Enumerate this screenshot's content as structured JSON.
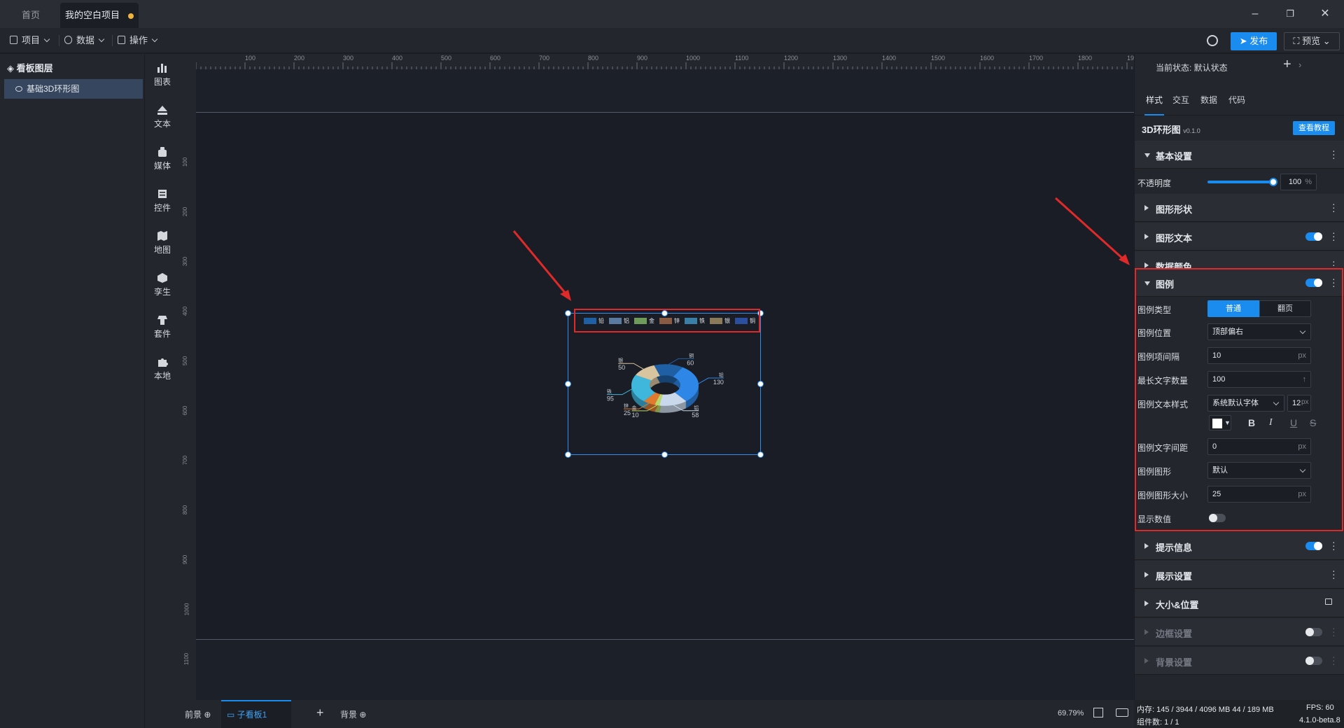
{
  "titlebar": {
    "tabs": [
      {
        "label": "首页"
      },
      {
        "label": "我的空白项目"
      }
    ]
  },
  "menubar": {
    "items": [
      {
        "label": "项目"
      },
      {
        "label": "数据"
      },
      {
        "label": "操作"
      }
    ],
    "publish_label": "发布",
    "preview_label": "预览"
  },
  "layers": {
    "title": "看板图层",
    "items": [
      {
        "label": "基础3D环形图"
      }
    ]
  },
  "toolbox": {
    "items": [
      {
        "label": "图表",
        "icon": "chart-icon"
      },
      {
        "label": "文本",
        "icon": "text-icon"
      },
      {
        "label": "媒体",
        "icon": "media-icon"
      },
      {
        "label": "控件",
        "icon": "control-icon"
      },
      {
        "label": "地图",
        "icon": "map-icon"
      },
      {
        "label": "孪生",
        "icon": "twin-icon"
      },
      {
        "label": "套件",
        "icon": "kit-icon"
      },
      {
        "label": "本地",
        "icon": "puzzle-icon"
      }
    ]
  },
  "ruler": {
    "top": [
      "100",
      "200",
      "300",
      "400",
      "500",
      "600",
      "700",
      "800",
      "900",
      "1000",
      "1100",
      "1200",
      "1300",
      "1400",
      "1500",
      "1600",
      "1700",
      "1800",
      "1900"
    ],
    "left": [
      "100",
      "200",
      "300",
      "400",
      "500",
      "600",
      "700",
      "800",
      "900",
      "1000",
      "1100"
    ]
  },
  "chart_widget": {
    "legend": [
      {
        "name": "铅",
        "color": "#1f5fa3"
      },
      {
        "name": "铝",
        "color": "#5a7aa0"
      },
      {
        "name": "金",
        "color": "#6e9a5a"
      },
      {
        "name": "锌",
        "color": "#8a5b43"
      },
      {
        "name": "铁",
        "color": "#3a7fa8"
      },
      {
        "name": "银",
        "color": "#8a7a5a"
      },
      {
        "name": "铜",
        "color": "#2b4f9e"
      }
    ]
  },
  "chart_data": {
    "type": "pie",
    "categories": [
      "铅",
      "铝",
      "金",
      "锌",
      "铁",
      "银",
      "铜"
    ],
    "values": [
      130,
      58,
      10,
      25,
      95,
      50,
      60
    ],
    "colors": [
      "#2e86e6",
      "#c9d8ea",
      "#b8d86a",
      "#e07a2e",
      "#3fb6dc",
      "#d9c4a0",
      "#1f5fa3"
    ],
    "title": "",
    "donut": true,
    "legend_position": "top-right"
  },
  "bottombar": {
    "front_label": "前景",
    "board_label": "子看板1",
    "back_label": "背景",
    "zoom": "69.79%"
  },
  "panel": {
    "state_label": "当前状态:  默认状态",
    "tabs": [
      "样式",
      "交互",
      "数据",
      "代码"
    ],
    "component_name": "3D环形图",
    "version": "v0.1.0",
    "tutorial_label": "查看教程",
    "sections": {
      "basic": "基本设置",
      "opacity_label": "不透明度",
      "opacity_value": "100",
      "opacity_unit": "%",
      "opacity_level": 1.0,
      "shape": "图形形状",
      "text": "图形文本",
      "color": "数据颜色",
      "legend": "图例",
      "tooltip": "提示信息",
      "display": "展示设置",
      "size": "大小&位置",
      "border": "边框设置",
      "background": "背景设置"
    },
    "legend_settings": {
      "type_label": "图例类型",
      "type_options": [
        "普通",
        "翻页"
      ],
      "position_label": "图例位置",
      "position_value": "顶部偏右",
      "spacing_label": "图例项间隔",
      "spacing_value": "10",
      "maxchars_label": "最长文字数量",
      "maxchars_value": "100",
      "textstyle_label": "图例文本样式",
      "font_value": "系统默认字体",
      "fontsize_value": "12",
      "letterspacing_label": "图例文字间距",
      "letterspacing_value": "0",
      "shape_label": "图例图形",
      "shape_value": "默认",
      "shapesize_label": "图例图形大小",
      "shapesize_value": "25",
      "showvalue_label": "显示数值",
      "unit_px": "px"
    }
  },
  "status": {
    "memory": "内存:  145 / 3944 / 4096 MB  44 / 189 MB",
    "fps": "FPS:  60",
    "components": "组件数: 1 / 1",
    "version": "4.1.0-beta.8"
  }
}
